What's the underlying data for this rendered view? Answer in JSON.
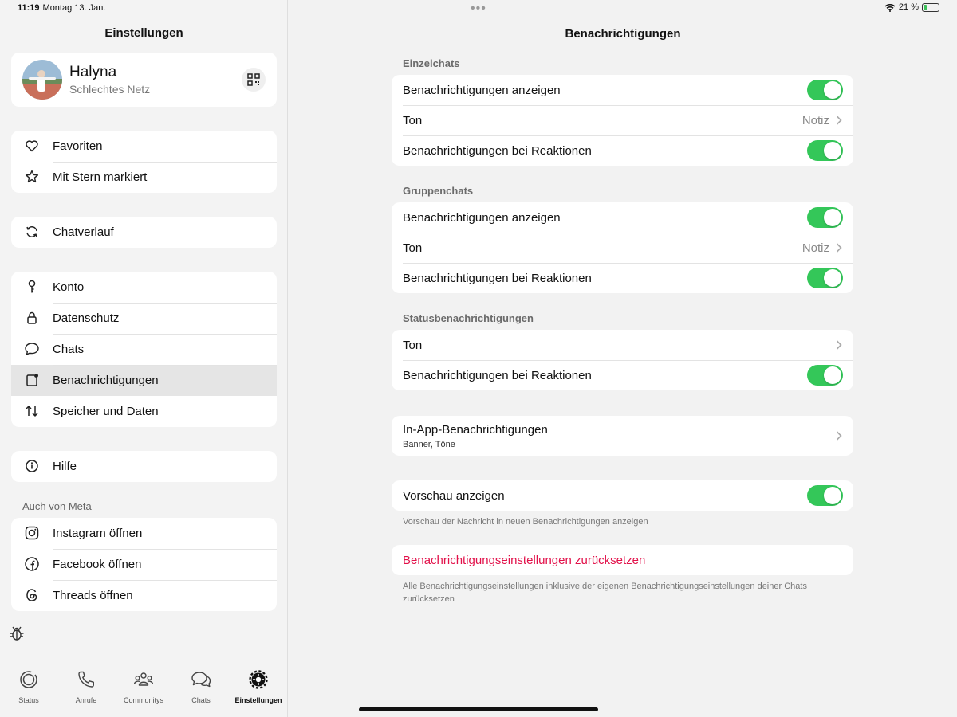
{
  "status_bar": {
    "time": "11:19",
    "date": "Montag 13. Jan.",
    "battery": "21 %",
    "battery_level": 0.21,
    "dots": "•••"
  },
  "sidebar": {
    "title": "Einstellungen",
    "profile": {
      "name": "Halyna",
      "status": "Schlechtes Netz"
    },
    "group1": [
      {
        "label": "Favoriten",
        "icon": "heart-icon"
      },
      {
        "label": "Mit Stern markiert",
        "icon": "star-icon"
      }
    ],
    "group2": [
      {
        "label": "Chatverlauf",
        "icon": "sync-icon"
      }
    ],
    "group3": [
      {
        "label": "Konto",
        "icon": "key-icon"
      },
      {
        "label": "Datenschutz",
        "icon": "lock-icon"
      },
      {
        "label": "Chats",
        "icon": "chat-bubble-icon"
      },
      {
        "label": "Benachrichtigungen",
        "icon": "notification-icon"
      },
      {
        "label": "Speicher und Daten",
        "icon": "arrows-updown-icon"
      }
    ],
    "group4": [
      {
        "label": "Hilfe",
        "icon": "info-icon"
      }
    ],
    "meta_label": "Auch von Meta",
    "meta_items": [
      {
        "label": "Instagram öffnen",
        "icon": "instagram-icon"
      },
      {
        "label": "Facebook öffnen",
        "icon": "facebook-icon"
      },
      {
        "label": "Threads öffnen",
        "icon": "threads-icon"
      }
    ]
  },
  "tabs": [
    {
      "label": "Status",
      "icon": "status-icon"
    },
    {
      "label": "Anrufe",
      "icon": "phone-icon"
    },
    {
      "label": "Communitys",
      "icon": "communities-icon"
    },
    {
      "label": "Chats",
      "icon": "chats-icon"
    },
    {
      "label": "Einstellungen",
      "icon": "settings-icon",
      "active": true
    }
  ],
  "main": {
    "title": "Benachrichtigungen",
    "einzel": {
      "label": "Einzelchats",
      "show": "Benachrichtigungen anzeigen",
      "tone": "Ton",
      "tone_value": "Notiz",
      "reactions": "Benachrichtigungen bei Reaktionen"
    },
    "gruppen": {
      "label": "Gruppenchats",
      "show": "Benachrichtigungen anzeigen",
      "tone": "Ton",
      "tone_value": "Notiz",
      "reactions": "Benachrichtigungen bei Reaktionen"
    },
    "status": {
      "label": "Statusbenachrichtigungen",
      "tone": "Ton",
      "reactions": "Benachrichtigungen bei Reaktionen"
    },
    "inapp": {
      "title": "In-App-Benachrichtigungen",
      "subtitle": "Banner, Töne"
    },
    "preview": {
      "label": "Vorschau anzeigen",
      "footnote": "Vorschau der Nachricht in neuen Benachrichtigungen anzeigen"
    },
    "reset": {
      "label": "Benachrichtigungseinstellungen zurücksetzen",
      "footnote": "Alle Benachrichtigungseinstellungen inklusive der eigenen Benachrichtigungseinstellungen deiner Chats zurücksetzen"
    },
    "toggles_on": true
  },
  "colors": {
    "toggle_on": "#34c759",
    "danger": "#e2114a",
    "battery": "#3cc05a"
  }
}
